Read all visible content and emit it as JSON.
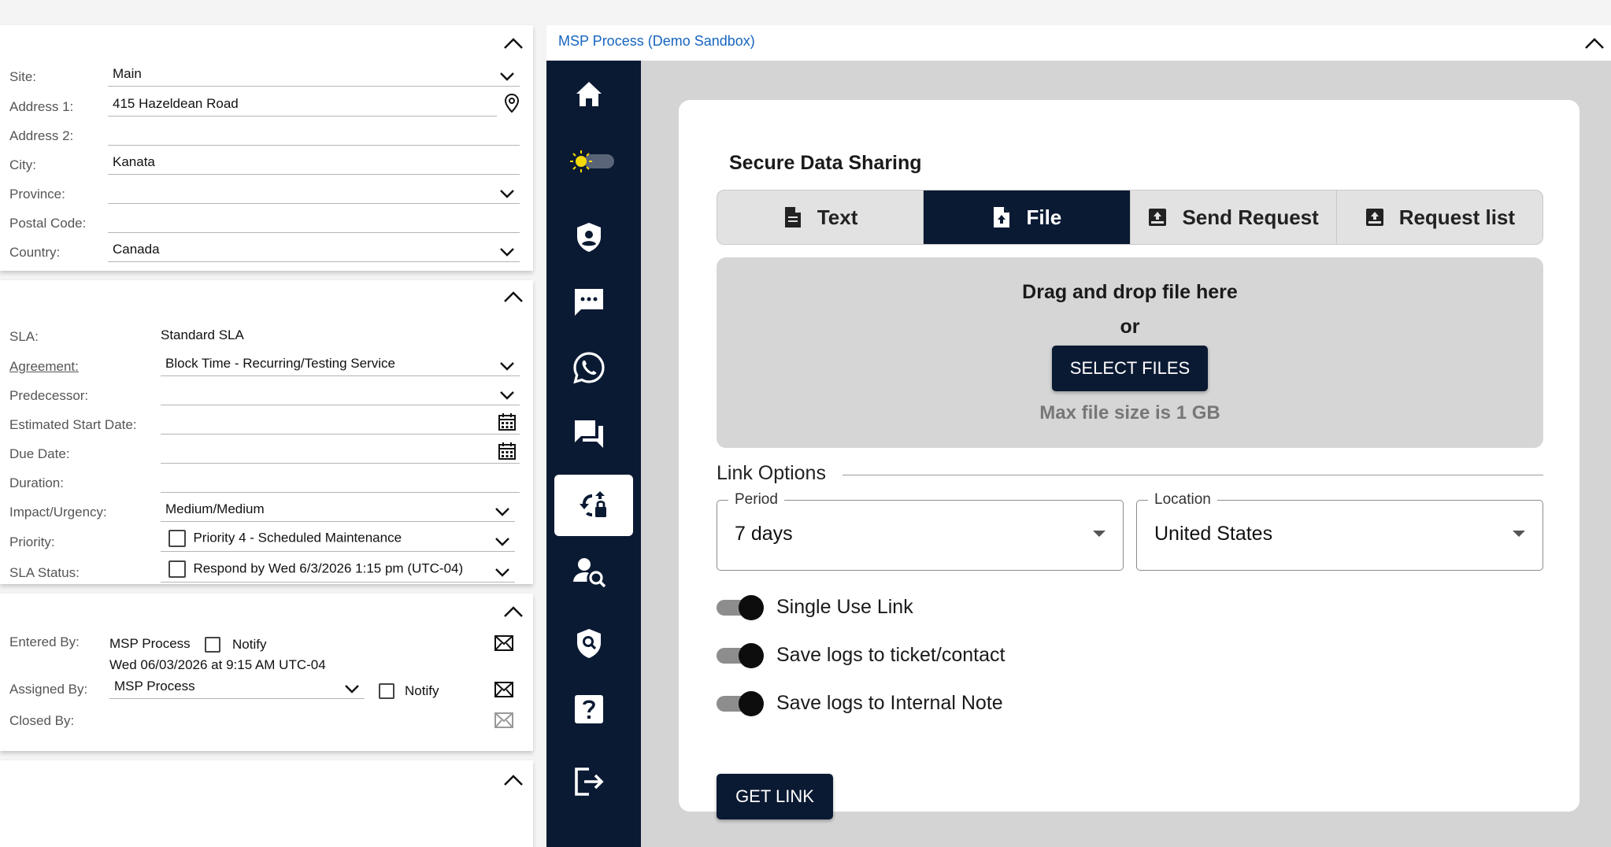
{
  "address": {
    "site": {
      "label": "Site:",
      "value": "Main"
    },
    "address1": {
      "label": "Address 1:",
      "value": "415 Hazeldean Road"
    },
    "address2": {
      "label": "Address 2:",
      "value": ""
    },
    "city": {
      "label": "City:",
      "value": "Kanata"
    },
    "province": {
      "label": "Province:",
      "value": ""
    },
    "postal": {
      "label": "Postal Code:",
      "value": ""
    },
    "country": {
      "label": "Country:",
      "value": "Canada"
    }
  },
  "sla": {
    "sla": {
      "label": "SLA:",
      "value": "Standard SLA"
    },
    "agreement": {
      "label": "Agreement:",
      "value": "Block Time - Recurring/Testing Service"
    },
    "predecessor": {
      "label": "Predecessor:",
      "value": ""
    },
    "est_start": {
      "label": "Estimated Start Date:",
      "value": ""
    },
    "due": {
      "label": "Due Date:",
      "value": ""
    },
    "duration": {
      "label": "Duration:",
      "value": ""
    },
    "impact": {
      "label": "Impact/Urgency:",
      "value": "Medium/Medium"
    },
    "priority": {
      "label": "Priority:",
      "value": "Priority 4 - Scheduled Maintenance"
    },
    "status": {
      "label": "SLA Status:",
      "value": "Respond by Wed 6/3/2026 1:15 pm (UTC-04)"
    }
  },
  "people": {
    "entered_label": "Entered By:",
    "entered_value": "MSP Process",
    "notify_label": "Notify",
    "entered_date": "Wed 06/03/2026 at 9:15 AM UTC-04",
    "assigned_label": "Assigned By:",
    "assigned_value": "MSP Process",
    "assigned_notify_label": "Notify",
    "closed_label": "Closed By:"
  },
  "window": {
    "title": "MSP Process (Demo Sandbox)"
  },
  "rail": {
    "icons": [
      "home-icon",
      "theme-toggle",
      "shield-user-icon",
      "chat-icon",
      "whatsapp-icon",
      "forum-icon",
      "secure-share-icon",
      "user-search-icon",
      "shield-search-icon",
      "help-icon",
      "logout-icon"
    ],
    "active": "secure-share-icon"
  },
  "secure": {
    "title": "Secure Data Sharing",
    "tabs": [
      {
        "label": "Text",
        "icon": "document-icon"
      },
      {
        "label": "File",
        "icon": "file-upload-icon"
      },
      {
        "label": "Send Request",
        "icon": "send-request-icon"
      },
      {
        "label": "Request list",
        "icon": "request-list-icon"
      }
    ],
    "active_tab": "File",
    "drop_title": "Drag and drop file here",
    "drop_or": "or",
    "select_files": "SELECT FILES",
    "max_size": "Max file size is 1 GB",
    "link_options_label": "Link Options",
    "period": {
      "label": "Period",
      "value": "7 days"
    },
    "location": {
      "label": "Location",
      "value": "United States"
    },
    "toggles": [
      {
        "label": "Single Use Link",
        "on": true
      },
      {
        "label": "Save logs to ticket/contact",
        "on": true
      },
      {
        "label": "Save logs to Internal Note",
        "on": true
      }
    ],
    "get_link": "GET LINK"
  },
  "colors": {
    "navy": "#0b1a33",
    "link_blue": "#1565c0",
    "content_bg": "#d4d4d4"
  }
}
